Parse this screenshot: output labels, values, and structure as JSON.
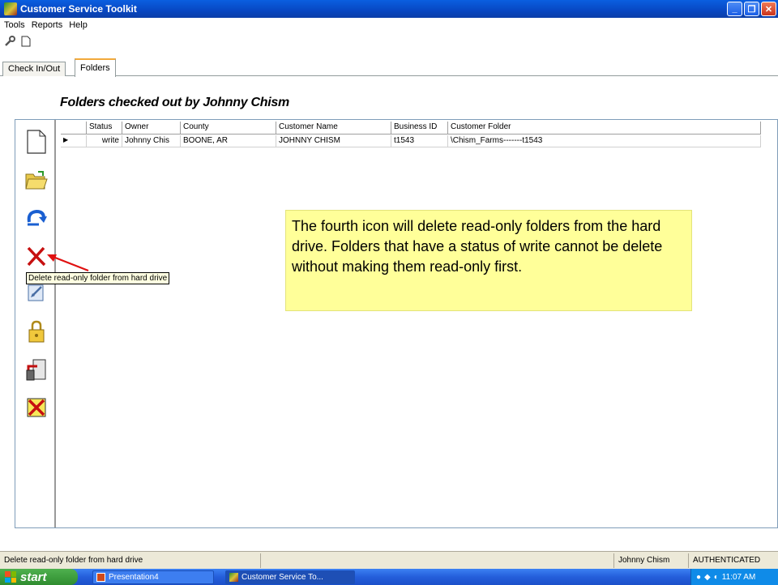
{
  "window": {
    "title": "Customer Service Toolkit",
    "min": "_",
    "max": "❐",
    "close": "✕"
  },
  "menu": [
    "Tools",
    "Reports",
    "Help"
  ],
  "tabs": [
    "Check In/Out",
    "Folders"
  ],
  "heading": "Folders checked out by Johnny Chism",
  "grid": {
    "columns": [
      "Status",
      "Owner",
      "County",
      "Customer Name",
      "Business ID",
      "Customer Folder"
    ],
    "rows": [
      [
        "write",
        "Johnny Chis",
        "BOONE, AR",
        "JOHNNY CHISM",
        "t1543",
        "\\Chism_Farms-------t1543"
      ]
    ]
  },
  "tooltip": "Delete read-only folder from hard drive",
  "callout": "The fourth icon will delete read-only folders from the hard drive. Folders that have a status of write cannot be delete without making them read-only  first.",
  "status": {
    "message": "Delete read-only folder from hard drive",
    "user": "Johnny Chism",
    "auth": "AUTHENTICATED"
  },
  "taskbar": {
    "start": "start",
    "tasks": [
      "Presentation4",
      "Customer Service To..."
    ],
    "clock": "11:07 AM"
  },
  "colors": {
    "callout_bg": "#ffff99",
    "arrow": "#e01010",
    "titlebar": "#0a5fe0"
  }
}
